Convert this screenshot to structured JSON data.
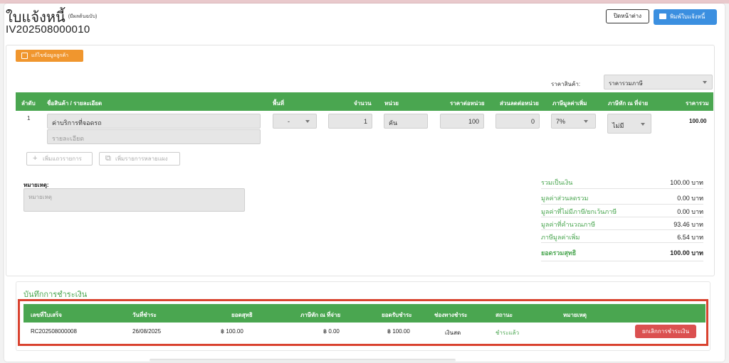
{
  "header": {
    "title": "ใบแจ้งหนี้",
    "title_sub": "(มีผลต้นฉบับ)",
    "doc_no": "IV202508000010",
    "close_label": "ปิดหน้าต่าง",
    "print_label": "พิมพ์ใบแจ้งหนี้",
    "print_icon": "printer-icon"
  },
  "customer": {
    "edit_label": "แก้ไขข้อมูลลูกค้า",
    "edit_icon": "edit-icon"
  },
  "pricing": {
    "label": "ราคาสินค้า:",
    "selected": "ราคารวมภาษี"
  },
  "items": {
    "headers": [
      "ลำดับ",
      "ชื่อสินค้า / รายละเอียด",
      "พื้นที่",
      "จำนวน",
      "หน่วย",
      "ราคาต่อหน่วย",
      "ส่วนลดต่อหน่วย",
      "ภาษีมูลค่าเพิ่ม",
      "ภาษีหัก ณ ที่จ่าย",
      "ราคารวม"
    ],
    "rows": [
      {
        "index": "1",
        "name": "ค่าบริการที่จอดรถ",
        "detail_placeholder": "รายละเอียด",
        "area": "-",
        "qty": "1",
        "unit": "คัน",
        "unit_price": "100",
        "discount": "0",
        "vat": "7%",
        "wht": "ไม่มี",
        "total": "100.00"
      }
    ],
    "add_row_label": "เพิ่มแถวรายการ",
    "add_multi_label": "เพิ่มรายการหลายแผง"
  },
  "notes": {
    "label": "หมายเหตุ:",
    "placeholder": "หมายเหตุ"
  },
  "summary": {
    "total_label": "รวมเป็นเงิน",
    "total_value": "100.00 บาท",
    "discount_label": "มูลค่าส่วนลดรวม",
    "discount_value": "0.00 บาท",
    "exempt_label": "มูลค่าที่ไม่มีภาษี/ยกเว้นภาษี",
    "exempt_value": "0.00 บาท",
    "taxable_label": "มูลค่าที่คำนวณภาษี",
    "taxable_value": "93.46 บาท",
    "vat_label": "ภาษีมูลค่าเพิ่ม",
    "vat_value": "6.54 บาท",
    "net_label": "ยอดรวมสุทธิ",
    "net_value": "100.00 บาท"
  },
  "payments": {
    "title": "บันทึกการชำระเงิน",
    "headers": [
      "เลขที่ใบเสร็จ",
      "วันที่ชำระ",
      "ยอดสุทธิ",
      "ภาษีหัก ณ ที่จ่าย",
      "ยอดรับชำระ",
      "ช่องทางชำระ",
      "สถานะ",
      "หมายเหตุ"
    ],
    "rows": [
      {
        "receipt_no": "RC202508000008",
        "date": "26/08/2025",
        "net": "฿ 100.00",
        "wht": "฿ 0.00",
        "received": "฿ 100.00",
        "channel": "เงินสด",
        "status": "ชำระแล้ว",
        "cancel_label": "ยกเลิกการชำระเงิน"
      }
    ]
  },
  "colors": {
    "green": "#4aa650",
    "blue": "#3b8fe0",
    "orange": "#f0962e",
    "red": "#db5050"
  }
}
